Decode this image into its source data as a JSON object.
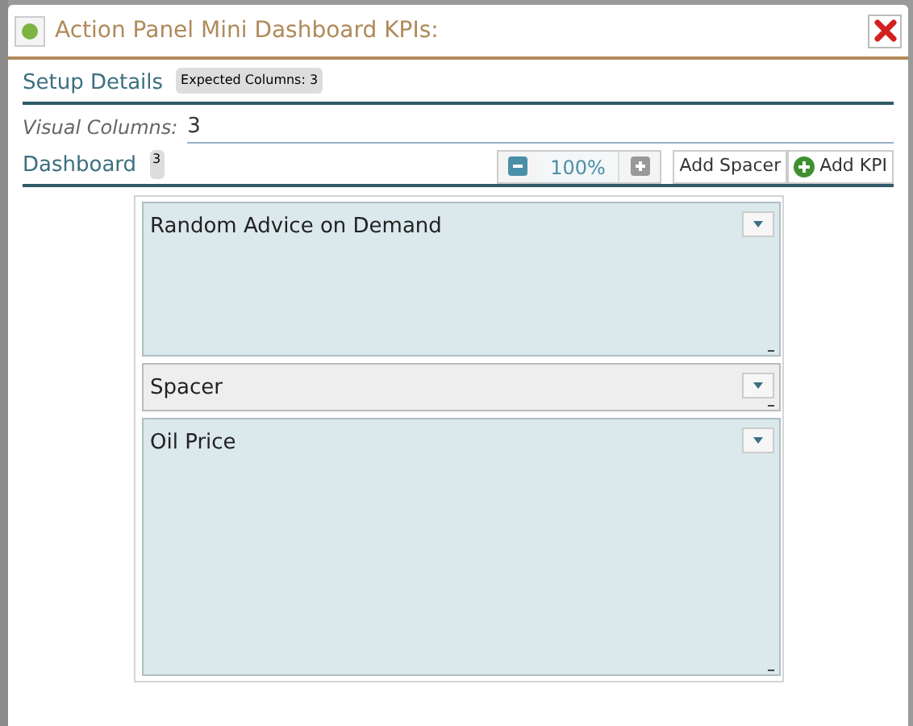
{
  "dialog": {
    "title": "Action Panel Mini Dashboard KPIs:"
  },
  "setup": {
    "heading": "Setup Details",
    "badge": "Expected Columns: 3"
  },
  "visual_columns": {
    "label": "Visual Columns:",
    "value": "3"
  },
  "dashboard": {
    "heading": "Dashboard",
    "badge": "3",
    "zoom": "100%",
    "buttons": [
      "Add Spacer",
      "Add KPI"
    ]
  },
  "tiles": [
    {
      "kind": "kpi",
      "title": "Random Advice on Demand"
    },
    {
      "kind": "spacer",
      "title": "Spacer"
    },
    {
      "kind": "kpi",
      "title": "Oil Price"
    }
  ]
}
